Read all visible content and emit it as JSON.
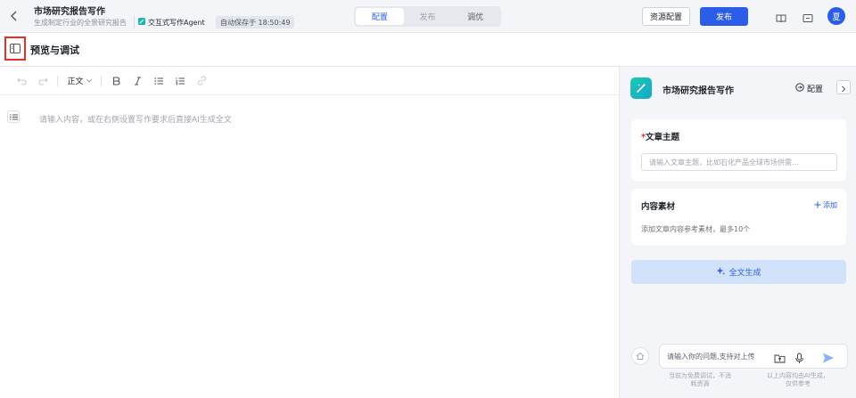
{
  "header": {
    "title": "市场研究报告写作",
    "subtitle": "生成制定行业的全景研究报告",
    "agent_label": "交互式写作Agent",
    "autosave": "自动保存于 18:50:49",
    "tabs": [
      {
        "label": "配置"
      },
      {
        "label": "发布"
      },
      {
        "label": "调优"
      }
    ],
    "resource_button": "资源配置",
    "publish_button": "发布",
    "avatar_text": "夏"
  },
  "section": {
    "title": "预览与调试"
  },
  "toolbar": {
    "paragraph_style": "正文"
  },
  "editor": {
    "placeholder": "请输入内容，或在右侧设置写作要求后直接AI生成全文"
  },
  "panel": {
    "app_name": "市场研究报告写作",
    "config_label": "配置",
    "topic": {
      "required_mark": "*",
      "label": "文章主题",
      "placeholder": "请输入文章主题，比如石化产品全球市场供需..."
    },
    "materials": {
      "label": "内容素材",
      "add_label": "添加",
      "hint": "添加文章内容参考素材，最多10个"
    },
    "generate_button": "全文生成",
    "chat": {
      "placeholder": "请输入你的问题,支持对上传"
    },
    "disclaimer_left": [
      "当前为免费调试，不消",
      "耗资源"
    ],
    "disclaimer_right": [
      "以上内容均由AI生成，",
      "仅供参考"
    ]
  },
  "colors": {
    "accent": "#2b5de8",
    "highlight_border": "#e5302b"
  }
}
